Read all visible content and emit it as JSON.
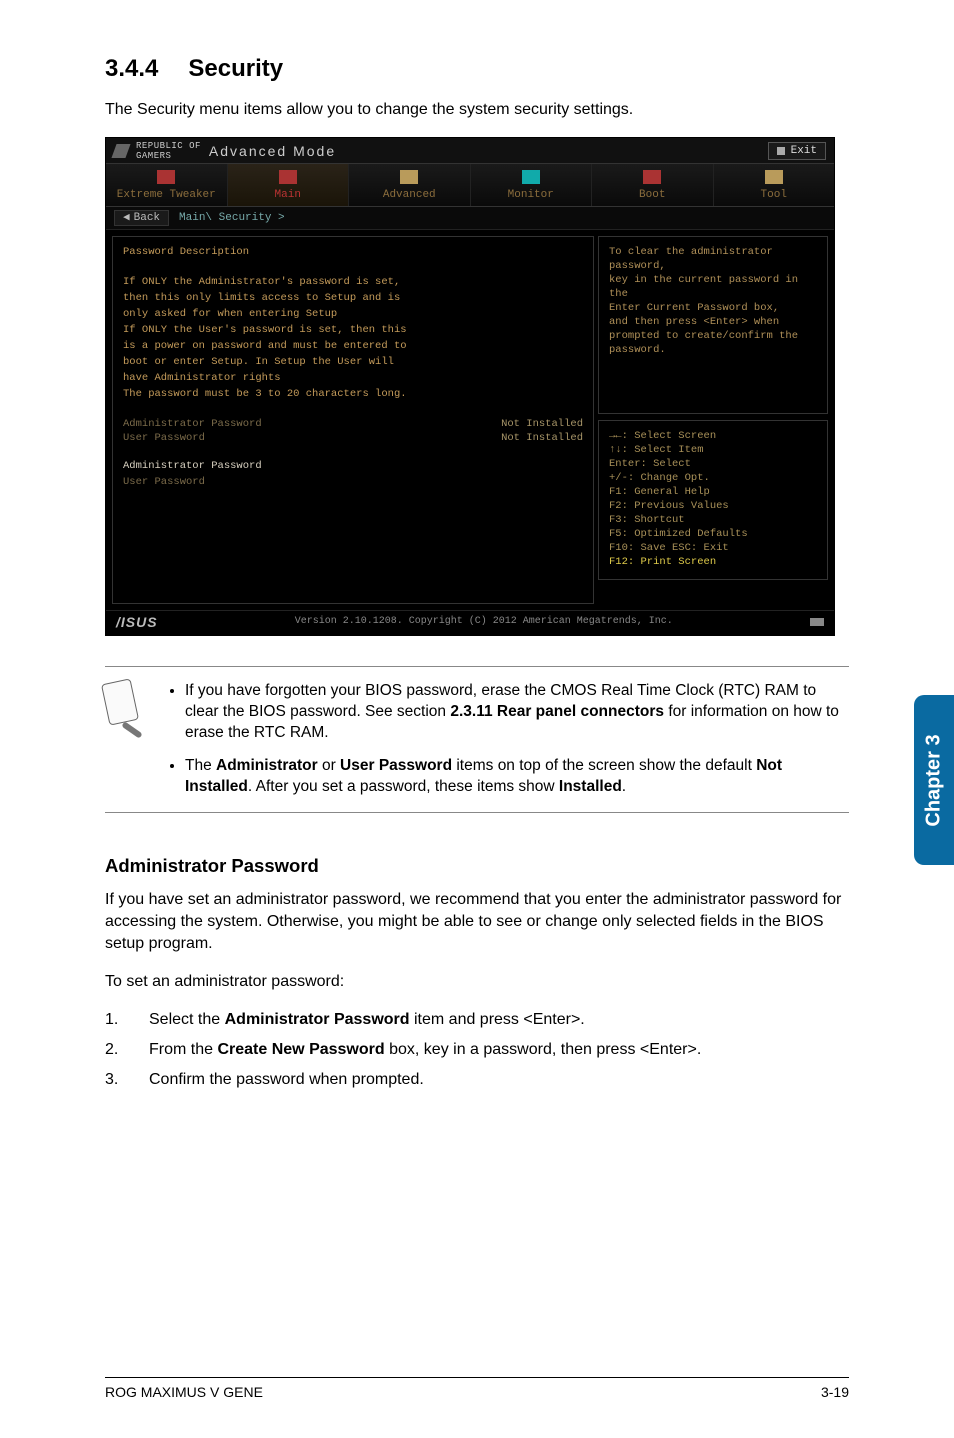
{
  "heading": {
    "number": "3.4.4",
    "title": "Security"
  },
  "intro": "The Security menu items allow you to change the system security settings.",
  "bios": {
    "brand_line1": "REPUBLIC OF",
    "brand_line2": "GAMERS",
    "mode": "Advanced Mode",
    "exit": "Exit",
    "tabs": {
      "extreme": "Extreme Tweaker",
      "main": "Main",
      "advanced": "Advanced",
      "monitor": "Monitor",
      "boot": "Boot",
      "tool": "Tool"
    },
    "breadcrumb": {
      "back": "Back",
      "path": "Main\\ Security >"
    },
    "left": {
      "title": "Password Description",
      "l1": "If ONLY the Administrator's password is set,",
      "l2": "then this only limits access to Setup and is",
      "l3": "only asked for when entering Setup",
      "l4": "If ONLY the User's password is set, then this",
      "l5": "is a power on password and must be entered to",
      "l6": "boot or enter Setup. In Setup the User will",
      "l7": "have Administrator rights",
      "l8": "The password must be 3 to 20 characters long.",
      "row1_label": "Administrator Password",
      "row1_val": "Not Installed",
      "row2_label": "User Password",
      "row2_val": "Not Installed",
      "item1": "Administrator Password",
      "item2": "User Password"
    },
    "help": {
      "l1": "To clear the administrator password,",
      "l2": "key in the current password in the",
      "l3": "Enter Current Password box,",
      "l4": "and then press <Enter> when",
      "l5": "prompted to create/confirm the",
      "l6": "password."
    },
    "keys": {
      "k1": "→←: Select Screen",
      "k2": "↑↓: Select Item",
      "k3": "Enter: Select",
      "k4": "+/-: Change Opt.",
      "k5": "F1: General Help",
      "k6": "F2: Previous Values",
      "k7": "F3: Shortcut",
      "k8": "F5: Optimized Defaults",
      "k9": "F10: Save  ESC: Exit",
      "k10": "F12: Print Screen"
    },
    "footer": {
      "logo": "/ISUS",
      "version": "Version 2.10.1208. Copyright (C) 2012 American Megatrends, Inc."
    }
  },
  "notes": {
    "n1a": "If you have forgotten your BIOS password, erase the CMOS Real Time Clock (RTC) RAM to clear the BIOS password. See section ",
    "n1b": "2.3.11 Rear panel connectors",
    "n1c": " for information on how to erase the RTC RAM.",
    "n2a": "The ",
    "n2b": "Administrator",
    "n2c": " or ",
    "n2d": "User Password",
    "n2e": " items on top of the screen show the default ",
    "n2f": "Not Installed",
    "n2g": ". After you set a password, these items show ",
    "n2h": "Installed",
    "n2i": "."
  },
  "chapter_tab": "Chapter 3",
  "admin": {
    "heading": "Administrator Password",
    "p1": "If you have set an administrator password, we recommend that you enter the administrator password for accessing the system. Otherwise, you might be able to see or change only selected fields in the BIOS setup program.",
    "p2": "To set an administrator password:",
    "s1a": "Select the ",
    "s1b": "Administrator Password",
    "s1c": " item and press <Enter>.",
    "s2a": "From the ",
    "s2b": "Create New Password",
    "s2c": " box, key in a password, then press <Enter>.",
    "s3": "Confirm the password when prompted."
  },
  "footer": {
    "left": "ROG MAXIMUS V GENE",
    "right": "3-19"
  },
  "list_numbers": {
    "one": "1.",
    "two": "2.",
    "three": "3."
  }
}
